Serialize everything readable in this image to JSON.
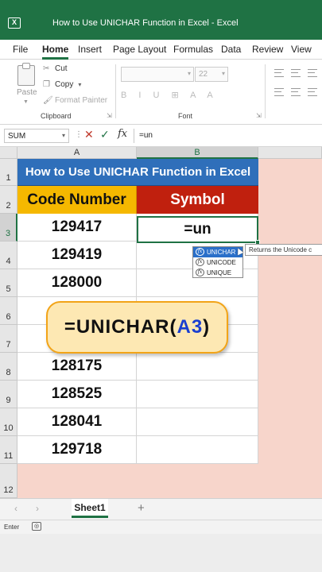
{
  "window": {
    "title": "How to Use UNICHAR Function in Excel  -  Excel",
    "app_icon": "excel-icon",
    "accent_color": "#1f7244"
  },
  "menu": {
    "tabs": [
      "File",
      "Home",
      "Insert",
      "Page Layout",
      "Formulas",
      "Data",
      "Review",
      "View"
    ],
    "active": "Home"
  },
  "ribbon": {
    "paste": "Paste",
    "cut": "Cut",
    "copy": "Copy",
    "format_painter": "Format Painter",
    "clipboard_group": "Clipboard",
    "font_group": "Font",
    "font_size": "22"
  },
  "formula_bar": {
    "name_box": "SUM",
    "fx": "fx",
    "content": "=un"
  },
  "grid": {
    "columns": [
      "A",
      "B"
    ],
    "rows": [
      "1",
      "2",
      "3",
      "4",
      "5",
      "6",
      "7",
      "8",
      "9",
      "10",
      "11",
      "12"
    ],
    "title_cell": "How to Use UNICHAR Function in Excel",
    "header_a": "Code Number",
    "header_b": "Symbol",
    "codes": [
      "129417",
      "129419",
      "128000",
      "128175",
      "128525",
      "128041",
      "129718"
    ],
    "editing_cell": "=un",
    "background_color": "#f7d5cb",
    "title_bg": "#2f6fba",
    "header_a_bg": "#f5b800",
    "header_b_bg": "#c0200e"
  },
  "autocomplete": {
    "items": [
      "UNICHAR",
      "UNICODE",
      "UNIQUE"
    ],
    "selected": "UNICHAR",
    "tooltip": "Returns the Unicode c"
  },
  "callout": {
    "prefix": "=UNICHAR(",
    "ref": "A3",
    "suffix": ")"
  },
  "sheets": {
    "tabs": [
      "Sheet1"
    ],
    "add": "+"
  },
  "status": {
    "mode": "Enter"
  }
}
